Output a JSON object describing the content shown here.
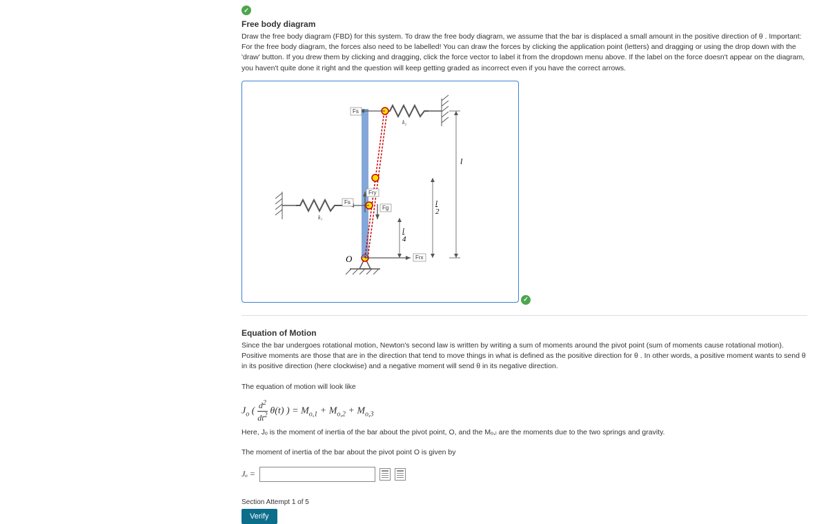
{
  "section1": {
    "title": "Free body diagram",
    "instructions": "Draw the free body diagram (FBD) for this system. To draw the free body diagram, we assume that the bar is displaced a small amount in the positive direction of θ .   Important: For the free body diagram, the forces also need to be labelled! You can draw the forces by clicking the application point (letters) and dragging or using the drop down with the 'draw' button. If you drew them by clicking and dragging, click the force vector to label it from the dropdown menu above.   If the label on the force doesn't appear on the diagram, you haven't quite done it right and the question will keep getting graded as incorrect even if you have the correct arrows."
  },
  "diagram": {
    "labels": {
      "k1": "k₁",
      "k2": "k₂",
      "l": "l",
      "l_half": "l/2",
      "l_quarter": "l/4",
      "origin": "O",
      "Fs_top": "Fs",
      "Fs_mid": "Fs",
      "Fry": "Fry",
      "Fg": "Fg",
      "Frx": "Frx"
    }
  },
  "section2": {
    "title": "Equation of Motion",
    "para1": "Since the bar undergoes rotational motion, Newton's second law is written by writing a sum of moments around the pivot point (sum of moments cause rotational motion). Positive moments are those that are in the direction that tend to move things in what is defined as the positive direction for θ .   In other words, a positive moment wants to send θ in its positive direction (here clockwise) and a negative moment will send θ in its negative direction.",
    "eq_intro": "The equation of motion will look like",
    "eq_after": "Here, Jₒ is the moment of inertia of the bar about the pivot point, O, and the Mₒ,ᵢ are the moments due to the two springs and gravity.",
    "inertia_prompt": "The moment of inertia of the bar about the pivot point O is given by",
    "Jo_label": "Jₒ ="
  },
  "footer": {
    "attempt": "Section   Attempt 1 of 5",
    "verify": "Verify"
  }
}
